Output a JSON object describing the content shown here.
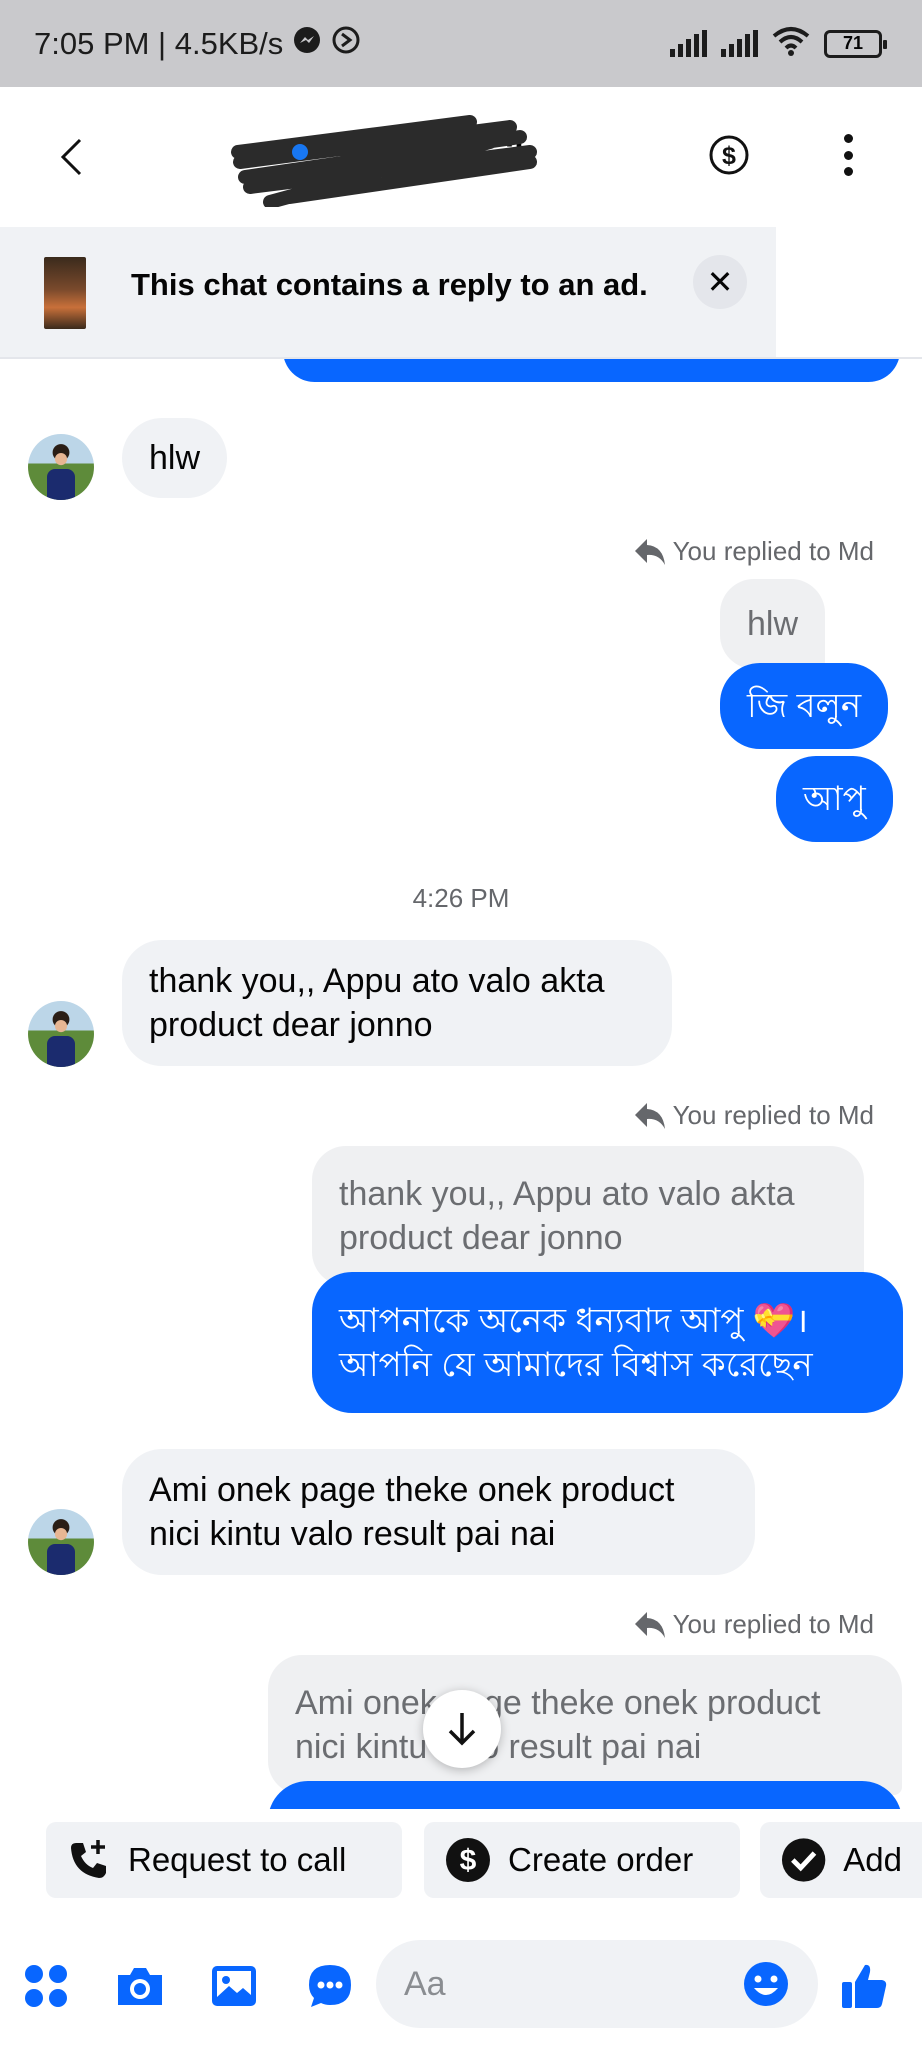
{
  "status_bar": {
    "time_speed": "7:05 PM | 4.5KB/s",
    "battery": "71"
  },
  "header": {
    "contact_name_visible": "ib"
  },
  "ad_banner": {
    "text": "This chat contains a reply to an ad."
  },
  "messages": {
    "m1": "hlw",
    "replied1": "You replied to Md",
    "q1": "hlw",
    "o1": "জি বলুন",
    "o2": "আপু",
    "time1": "4:26 PM",
    "m2_line1": "thank you,, Appu ato valo akta",
    "m2_line2": "product dear jonno",
    "replied2": "You replied to Md",
    "q2_line1": "thank you,, Appu ato valo akta",
    "q2_line2": "product dear jonno",
    "o3_line1": "আপনাকে অনেক ধন্যবাদ আপু 💝।",
    "o3_line2": "আপনি যে আমাদের বিশ্বাস করেছেন",
    "m3_line1": "Ami onek page theke onek product",
    "m3_line2": "nici kintu valo result pai nai",
    "replied3": "You replied to Md",
    "q3_line1": "Ami onek page theke onek product",
    "q3_line2": "nici kintu valo result pai nai"
  },
  "quick_actions": {
    "request_call": "Request to call",
    "create_order": "Create order",
    "add": "Add"
  },
  "composer": {
    "placeholder": "Aa"
  },
  "colors": {
    "accent": "#0866ff",
    "bubble_in": "#f0f2f5",
    "status_bar": "#c9c9cc"
  }
}
